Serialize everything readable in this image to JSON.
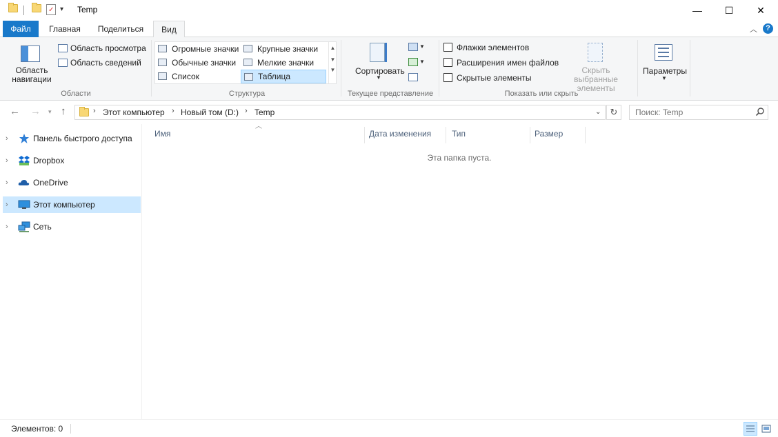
{
  "window": {
    "title": "Temp",
    "minimize": "—",
    "maximize": "☐",
    "close": "✕"
  },
  "tabs": [
    {
      "label": "Файл"
    },
    {
      "label": "Главная"
    },
    {
      "label": "Поделиться"
    },
    {
      "label": "Вид"
    }
  ],
  "ribbon": {
    "areas": {
      "nav_pane_label": "Область навигации",
      "preview_pane": "Область просмотра",
      "details_pane": "Область сведений",
      "group": "Области"
    },
    "layout": {
      "items": [
        "Огромные значки",
        "Крупные значки",
        "Обычные значки",
        "Мелкие значки",
        "Список",
        "Таблица"
      ],
      "selected": "Таблица",
      "group": "Структура"
    },
    "current_view": {
      "sort": "Сортировать",
      "group": "Текущее представление"
    },
    "show_hide": {
      "checkboxes": [
        "Флажки элементов",
        "Расширения имен файлов",
        "Скрытые элементы"
      ],
      "hide_selected": "Скрыть выбранные элементы",
      "group": "Показать или скрыть"
    },
    "options": {
      "label": "Параметры"
    }
  },
  "address": {
    "segments": [
      "Этот компьютер",
      "Новый том (D:)",
      "Temp"
    ]
  },
  "search": {
    "placeholder": "Поиск: Temp"
  },
  "nav_tree": [
    {
      "label": "Панель быстрого доступа",
      "icon": "star-icon"
    },
    {
      "label": "Dropbox",
      "icon": "dropbox-icon"
    },
    {
      "label": "OneDrive",
      "icon": "cloud-icon"
    },
    {
      "label": "Этот компьютер",
      "icon": "computer-icon",
      "selected": true
    },
    {
      "label": "Сеть",
      "icon": "network-icon"
    }
  ],
  "columns": [
    "Имя",
    "Дата изменения",
    "Тип",
    "Размер"
  ],
  "empty_message": "Эта папка пуста.",
  "status": {
    "items": "Элементов: 0"
  },
  "colors": {
    "accent": "#1979ca",
    "selection": "#cce8ff",
    "ribbon_bg": "#f5f6f7"
  }
}
